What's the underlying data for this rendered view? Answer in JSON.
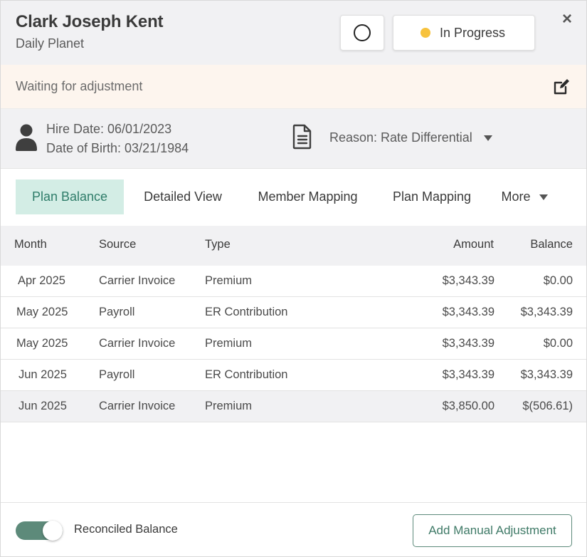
{
  "header": {
    "name": "Clark Joseph Kent",
    "company": "Daily Planet",
    "status_label": "In Progress",
    "status_color": "#f7c23d",
    "close_label": "×"
  },
  "note": {
    "text": "Waiting for adjustment"
  },
  "info": {
    "hire_date": "Hire Date: 06/01/2023",
    "date_of_birth": "Date of Birth: 03/21/1984",
    "reason": "Reason: Rate Differential"
  },
  "tabs": [
    {
      "label": "Plan Balance",
      "active": true
    },
    {
      "label": "Detailed View"
    },
    {
      "label": "Member Mapping"
    },
    {
      "label": "Plan Mapping"
    },
    {
      "label": "More"
    }
  ],
  "table": {
    "columns": [
      "Month",
      "Source",
      "Type",
      "Amount",
      "Balance"
    ],
    "rows": [
      {
        "month": "Apr 2025",
        "source": "Carrier Invoice",
        "type": "Premium",
        "amount": "$3,343.39",
        "balance": "$0.00"
      },
      {
        "month": "May 2025",
        "source": "Payroll",
        "type": "ER Contribution",
        "amount": "$3,343.39",
        "balance": "$3,343.39"
      },
      {
        "month": "May 2025",
        "source": "Carrier Invoice",
        "type": "Premium",
        "amount": "$3,343.39",
        "balance": "$0.00"
      },
      {
        "month": "Jun 2025",
        "source": "Payroll",
        "type": "ER Contribution",
        "amount": "$3,343.39",
        "balance": "$3,343.39"
      },
      {
        "month": "Jun 2025",
        "source": "Carrier Invoice",
        "type": "Premium",
        "amount": "$3,850.00",
        "balance": "$(506.61)",
        "highlighted": true
      }
    ]
  },
  "footer": {
    "toggle_label": "Reconciled Balance",
    "toggle_on": true,
    "add_button": "Add Manual Adjustment"
  },
  "colors": {
    "accent": "#5d8a7a",
    "tab_active_bg": "#d3ede5",
    "header_bg": "#f1f1f3",
    "note_bg": "#fdf5ee"
  }
}
